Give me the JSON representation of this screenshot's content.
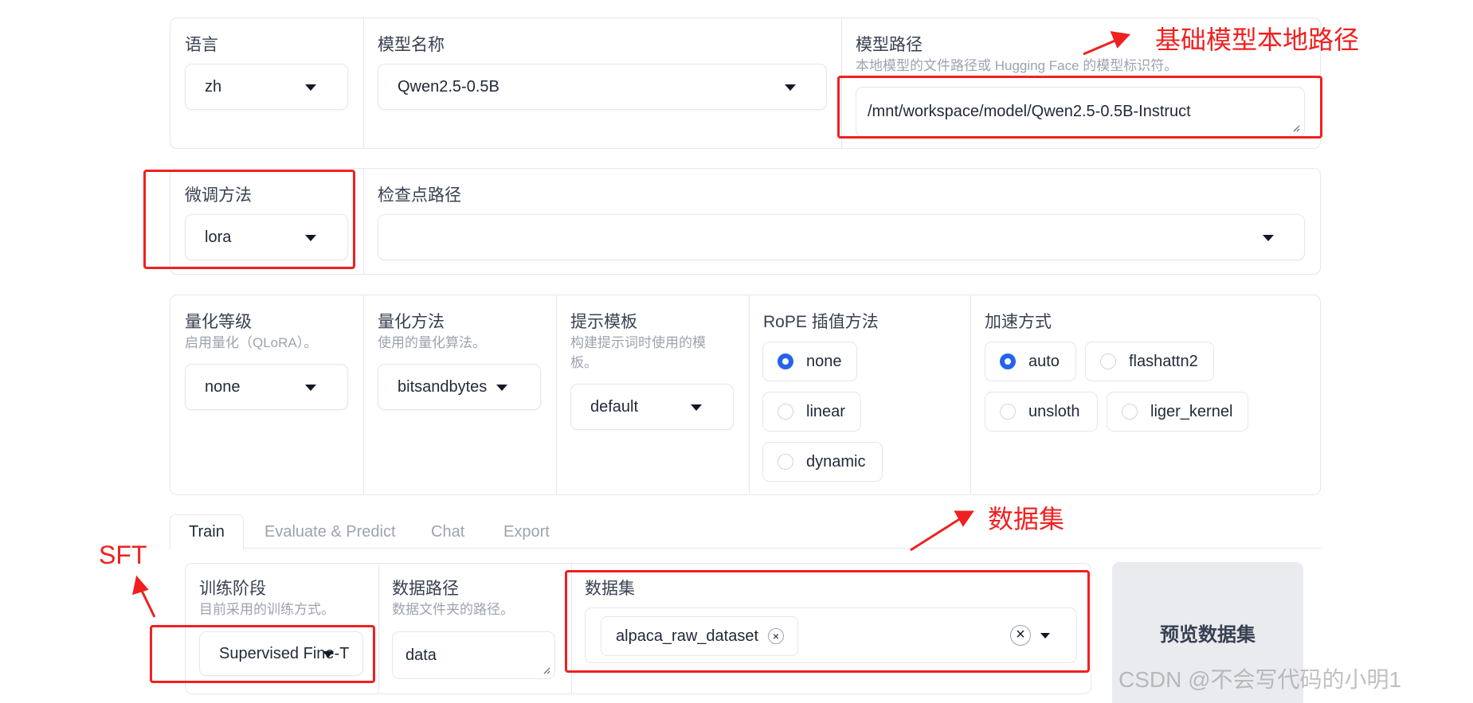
{
  "model_row": {
    "language": {
      "label": "语言",
      "value": "zh"
    },
    "model_name": {
      "label": "模型名称",
      "value": "Qwen2.5-0.5B"
    },
    "model_path": {
      "label": "模型路径",
      "info": "本地模型的文件路径或 Hugging Face 的模型标识符。",
      "value": "/mnt/workspace/model/Qwen2.5-0.5B-Instruct"
    }
  },
  "finetune_row": {
    "method": {
      "label": "微调方法",
      "value": "lora"
    },
    "checkpoint": {
      "label": "检查点路径",
      "value": ""
    }
  },
  "advanced_row": {
    "quant_bit": {
      "label": "量化等级",
      "info": "启用量化（QLoRA）。",
      "value": "none"
    },
    "quant_method": {
      "label": "量化方法",
      "info": "使用的量化算法。",
      "value": "bitsandbytes"
    },
    "template": {
      "label": "提示模板",
      "info_line1": "构建提示词时使用的模",
      "info_line2": "板。",
      "value": "default"
    },
    "rope": {
      "label": "RoPE 插值方法",
      "options": [
        "none",
        "linear",
        "dynamic"
      ],
      "selected": "none"
    },
    "booster": {
      "label": "加速方式",
      "options": [
        "auto",
        "flashattn2",
        "unsloth",
        "liger_kernel"
      ],
      "selected": "auto"
    }
  },
  "tabs": [
    "Train",
    "Evaluate & Predict",
    "Chat",
    "Export"
  ],
  "active_tab": "Train",
  "train": {
    "stage": {
      "label": "训练阶段",
      "info": "目前采用的训练方式。",
      "value": "Supervised Fine-T"
    },
    "dataset_dir": {
      "label": "数据路径",
      "info": "数据文件夹的路径。",
      "value": "data"
    },
    "dataset": {
      "label": "数据集",
      "chips": [
        "alpaca_raw_dataset"
      ]
    },
    "preview_button": "预览数据集"
  },
  "annotations": {
    "base_model_path": "基础模型本地路径",
    "dataset": "数据集",
    "sft": "SFT"
  },
  "watermark": "CSDN @不会写代码的小明1",
  "colors": {
    "accent": "#2563eb",
    "annotation": "#f02020",
    "border": "#e5e7eb"
  }
}
